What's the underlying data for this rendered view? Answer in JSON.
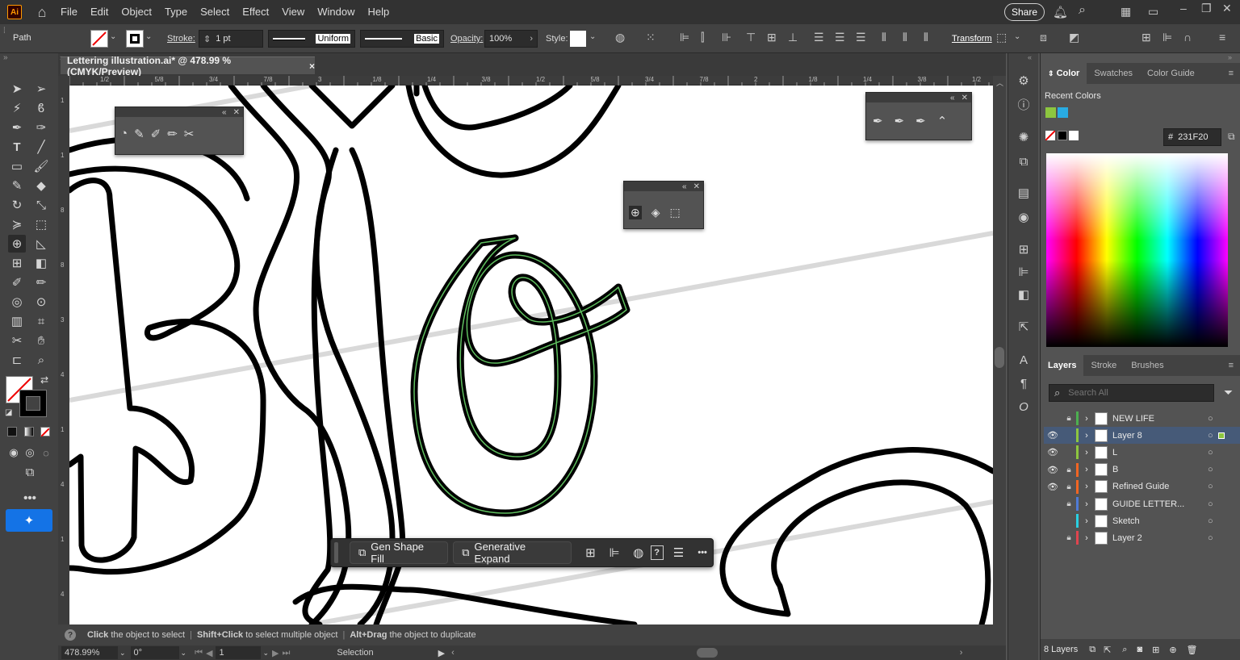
{
  "app": {
    "logo": "Ai"
  },
  "menu": [
    "File",
    "Edit",
    "Object",
    "Type",
    "Select",
    "Effect",
    "View",
    "Window",
    "Help"
  ],
  "topright": {
    "share": "Share"
  },
  "control": {
    "selection_type": "Path",
    "stroke_label": "Stroke:",
    "stroke_weight": "1 pt",
    "profile": "Uniform",
    "brush": "Basic",
    "opacity_label": "Opacity:",
    "opacity": "100%",
    "style_label": "Style:",
    "transform": "Transform"
  },
  "document": {
    "tab_title": "Lettering illustration.ai* @ 478.99 % (CMYK/Preview)",
    "close": "×"
  },
  "rulers": {
    "top": [
      "1/2",
      "5/8",
      "3/4",
      "7/8",
      "3",
      "1/8",
      "1/4",
      "3/8",
      "1/2",
      "5/8",
      "3/4",
      "7/8",
      "2",
      "1/8",
      "1/4",
      "3/8",
      "1/2"
    ],
    "left": [
      "1",
      "1",
      "8",
      "8",
      "3",
      "4",
      "1",
      "4",
      "1",
      "4"
    ]
  },
  "taskbar": {
    "gen_shape_fill": "Gen Shape Fill",
    "generative_expand": "Generative Expand",
    "help": "?",
    "more": "•••"
  },
  "status": {
    "hint_1_bold": "Click",
    "hint_1": " the object to select",
    "hint_2_bold": "Shift+Click",
    "hint_2": " to select multiple object",
    "hint_3_bold": "Alt+Drag",
    "hint_3": " the object to duplicate",
    "zoom": "478.99%",
    "rotation": "0°",
    "artboard": "1",
    "tool": "Selection"
  },
  "color_panel": {
    "tabs": [
      "Color",
      "Swatches",
      "Color Guide"
    ],
    "recent_label": "Recent Colors",
    "recent": [
      "#8dc63f",
      "#29abe2"
    ],
    "hex": "231F20"
  },
  "layers_panel": {
    "tabs": [
      "Layers",
      "Stroke",
      "Brushes"
    ],
    "search_placeholder": "Search All",
    "layers": [
      {
        "name": "NEW LIFE",
        "visible": false,
        "locked": true,
        "color": "#4caf50",
        "selected": false
      },
      {
        "name": "Layer 8",
        "visible": true,
        "locked": false,
        "color": "#8dc63f",
        "selected": true
      },
      {
        "name": "L",
        "visible": true,
        "locked": false,
        "color": "#8dc63f",
        "selected": false
      },
      {
        "name": "B",
        "visible": true,
        "locked": true,
        "color": "#f26522",
        "selected": false
      },
      {
        "name": "Refined Guide",
        "visible": true,
        "locked": true,
        "color": "#f26522",
        "selected": false
      },
      {
        "name": "GUIDE LETTER...",
        "visible": false,
        "locked": true,
        "color": "#4f7bd6",
        "selected": false
      },
      {
        "name": "Sketch",
        "visible": false,
        "locked": false,
        "color": "#29d0e2",
        "selected": false
      },
      {
        "name": "Layer 2",
        "visible": false,
        "locked": true,
        "color": "#e0444e",
        "selected": false
      }
    ],
    "footer_count": "8 Layers"
  }
}
